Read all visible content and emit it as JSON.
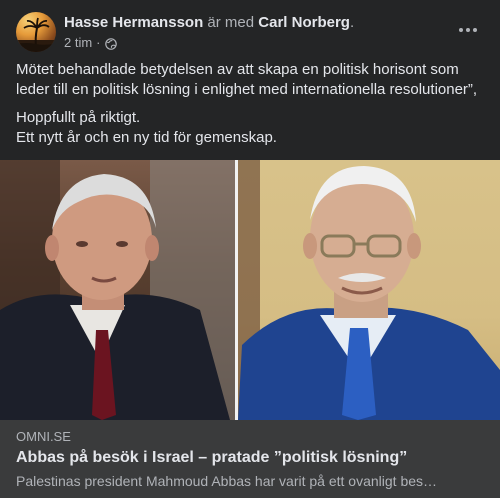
{
  "post": {
    "author": "Hasse Hermansson",
    "with_text": "är med",
    "tagged": "Carl Norberg",
    "tagged_suffix": ".",
    "time": "2 tim",
    "separator": "·",
    "privacy_icon": "globe-icon",
    "more_icon": "more-options-icon",
    "text": {
      "paragraph1": "Mötet behandlade betydelsen av att skapa en politisk horisont som leder till en politisk lösning i enlighet med internationella resolutioner”,",
      "paragraph2_line1": "Hoppfullt på riktigt.",
      "paragraph2_line2": "Ett nytt år och en ny tid för gemenskap."
    }
  },
  "link_preview": {
    "domain": "OMNI.SE",
    "title": "Abbas på besök i Israel – pratade ”politisk lösning”",
    "description": "Palestinas president Mahmoud Abbas har varit på ett ovanligt bes…"
  },
  "colors": {
    "post_background": "#242526",
    "link_box_background": "#3a3b3c",
    "primary_text": "#e4e6eb",
    "secondary_text": "#b0b3b8"
  }
}
